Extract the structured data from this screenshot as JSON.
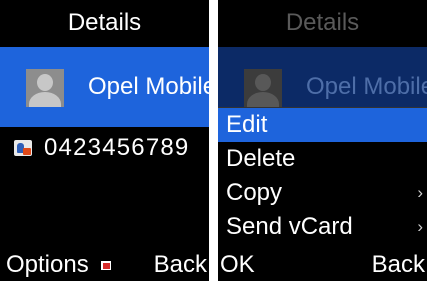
{
  "left_screen": {
    "header_title": "Details",
    "contact": {
      "name": "Opel Mobile"
    },
    "phone_number": "0423456789",
    "softkeys": {
      "left": "Options",
      "right": "Back"
    },
    "icons": {
      "avatar": "person-silhouette-icon",
      "phone_type": "contact-card-icon",
      "options_indicator": "options-indicator-icon"
    }
  },
  "right_screen": {
    "header_title": "Details",
    "contact": {
      "name": "Opel Mobile"
    },
    "menu": {
      "items": [
        {
          "label": "Edit",
          "selected": true,
          "has_submenu": false
        },
        {
          "label": "Delete",
          "selected": false,
          "has_submenu": false
        },
        {
          "label": "Copy",
          "selected": false,
          "has_submenu": true
        },
        {
          "label": "Send vCard",
          "selected": false,
          "has_submenu": true
        }
      ],
      "submenu_glyph": "›"
    },
    "softkeys": {
      "left": "OK",
      "right": "Back"
    }
  },
  "colors": {
    "highlight": "#1e64dc",
    "background": "#000000",
    "text": "#ffffff"
  }
}
